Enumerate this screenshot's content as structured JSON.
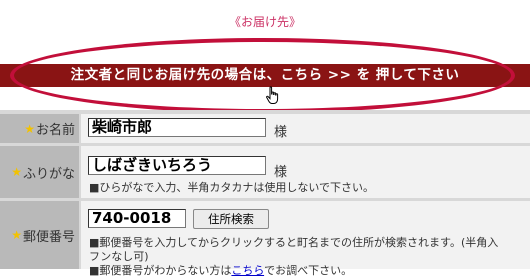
{
  "header": {
    "title": "《お届け先》"
  },
  "banner": {
    "text": "注文者と同じお届け先の場合は、こちら >> を 押して下さい"
  },
  "form": {
    "name": {
      "label": "お名前",
      "value": "柴崎市郎",
      "suffix": "様"
    },
    "furigana": {
      "label": "ふりがな",
      "value": "しばざきいちろう",
      "suffix": "様",
      "note": "■ひらがなで入力、半角カタカナは使用しないで下さい。"
    },
    "postal": {
      "label": "郵便番号",
      "value": "740-0018",
      "button": "住所検索",
      "note1": "■郵便番号を入力してからクリックすると町名までの住所が検索されます。(半角入",
      "note2": "フンなし可)",
      "note3_pre": "■郵便番号がわからない方は",
      "note3_link": "こちら",
      "note3_post": "でお調べ下さい。"
    }
  },
  "colors": {
    "banner_bg": "#8a1414",
    "highlight_ellipse": "#c20f3a",
    "required_star": "#f2c200"
  },
  "icons": {
    "required": "star-icon",
    "cursor": "hand-pointer-icon"
  }
}
